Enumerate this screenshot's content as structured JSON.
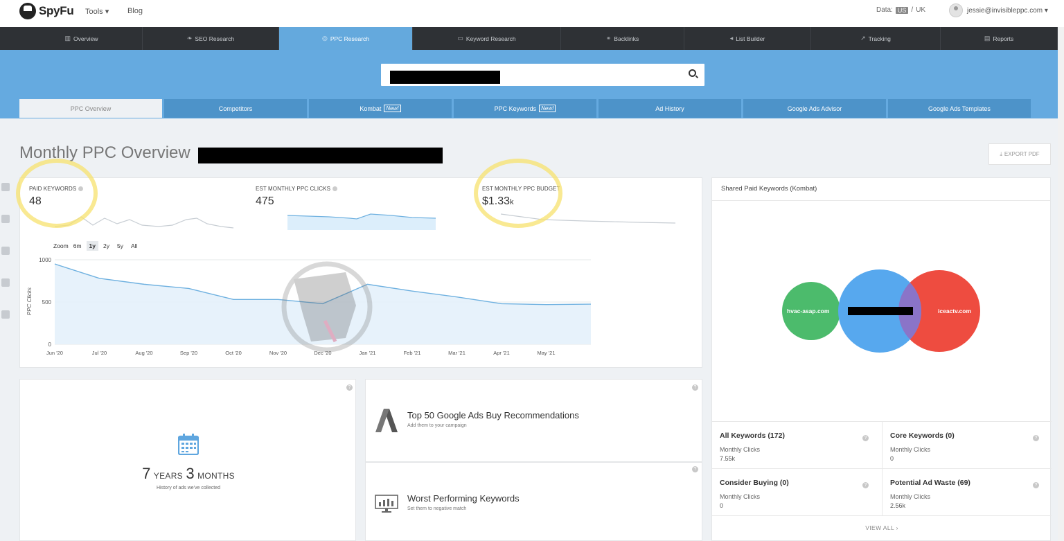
{
  "topbar": {
    "logo": "SpyFu",
    "tools": "Tools ▾",
    "blog": "Blog",
    "data_label": "Data:",
    "data_us": "US",
    "data_sep": "/",
    "data_uk": "UK",
    "user_email": "jessie@invisibleppc.com ▾"
  },
  "mainnav": [
    {
      "label": "Overview",
      "icon": "bar-chart-icon"
    },
    {
      "label": "SEO Research",
      "icon": "leaf-icon"
    },
    {
      "label": "PPC Research",
      "icon": "target-icon"
    },
    {
      "label": "Keyword Research",
      "icon": "keyboard-icon"
    },
    {
      "label": "Backlinks",
      "icon": "link-icon"
    },
    {
      "label": "List Builder",
      "icon": "megaphone-icon"
    },
    {
      "label": "Tracking",
      "icon": "line-chart-icon"
    },
    {
      "label": "Reports",
      "icon": "document-icon"
    }
  ],
  "subtabs": [
    {
      "label": "PPC Overview"
    },
    {
      "label": "Competitors"
    },
    {
      "label": "Kombat",
      "badge": "New!"
    },
    {
      "label": "PPC Keywords",
      "badge": "New!"
    },
    {
      "label": "Ad History"
    },
    {
      "label": "Google Ads Advisor"
    },
    {
      "label": "Google Ads Templates"
    }
  ],
  "page": {
    "title": "Monthly PPC Overview",
    "export_label": "EXPORT PDF"
  },
  "metrics": {
    "paid_keywords_label": "PAID KEYWORDS",
    "paid_keywords_value": "48",
    "clicks_label": "EST MONTHLY PPC CLICKS",
    "clicks_value": "475",
    "budget_label": "EST MONTHLY PPC BUDGET",
    "budget_value": "$1.33",
    "budget_suffix": "k"
  },
  "zoom": {
    "label": "Zoom",
    "options": [
      "6m",
      "1y",
      "2y",
      "5y",
      "All"
    ],
    "selected": "1y"
  },
  "chart_data": {
    "type": "area",
    "ylabel": "PPC Clicks",
    "ylim": [
      0,
      1000
    ],
    "yticks": [
      "1000",
      "500",
      "0"
    ],
    "x": [
      "Jun '20",
      "Jul '20",
      "Aug '20",
      "Sep '20",
      "Oct '20",
      "Nov '20",
      "Dec '20",
      "Jan '21",
      "Feb '21",
      "Mar '21",
      "Apr '21",
      "May '21"
    ],
    "values": [
      950,
      780,
      710,
      660,
      530,
      530,
      480,
      710,
      630,
      560,
      480,
      470,
      475
    ],
    "color": "#6fb1e0"
  },
  "history": {
    "years": "7",
    "years_unit": "YEARS",
    "months": "3",
    "months_unit": "MONTHS",
    "caption": "History of ads we've collected"
  },
  "recommendations": {
    "title": "Top 50 Google Ads Buy Recommendations",
    "subtitle": "Add them to your campaign"
  },
  "worst": {
    "title": "Worst Performing Keywords",
    "subtitle": "Set them to negative match"
  },
  "kombat": {
    "title": "Shared Paid Keywords (Kombat)",
    "left_domain": "hvac-asap.com",
    "right_domain": "iceactv.com",
    "colors": {
      "left": "#4cbb6c",
      "center": "#57a8ee",
      "right": "#ee4c40",
      "overlap": "#8a74c8"
    },
    "stats": [
      {
        "title": "All Keywords (172)",
        "sub": "Monthly Clicks",
        "value": "7.55k"
      },
      {
        "title": "Core Keywords (0)",
        "sub": "Monthly Clicks",
        "value": "0"
      },
      {
        "title": "Consider Buying (0)",
        "sub": "Monthly Clicks",
        "value": "0"
      },
      {
        "title": "Potential Ad Waste (69)",
        "sub": "Monthly Clicks",
        "value": "2.56k"
      }
    ],
    "view_all": "VIEW ALL ›"
  }
}
